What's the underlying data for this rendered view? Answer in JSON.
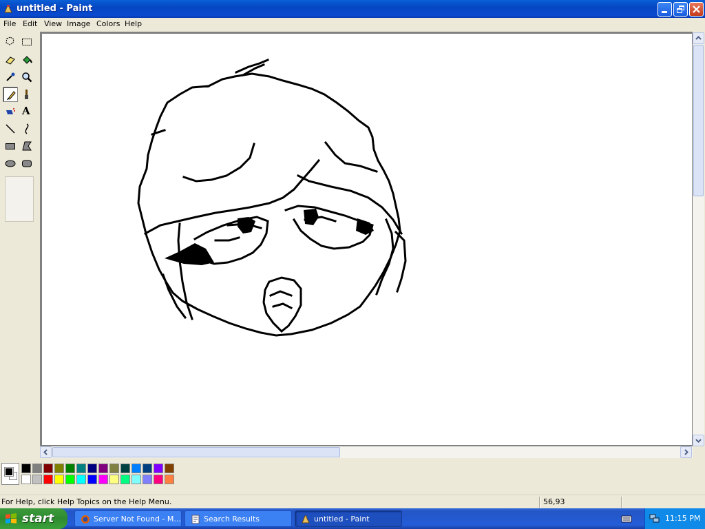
{
  "window": {
    "title": "untitled - Paint",
    "controls": [
      "minimize",
      "restore",
      "close"
    ]
  },
  "menu": [
    "File",
    "Edit",
    "View",
    "Image",
    "Colors",
    "Help"
  ],
  "tools": [
    {
      "name": "free-form-select",
      "icon": "free-select-icon"
    },
    {
      "name": "select",
      "icon": "rect-select-icon"
    },
    {
      "name": "eraser",
      "icon": "eraser-icon"
    },
    {
      "name": "fill-with-color",
      "icon": "fill-bucket-icon"
    },
    {
      "name": "pick-color",
      "icon": "eyedropper-icon"
    },
    {
      "name": "magnifier",
      "icon": "magnifier-icon"
    },
    {
      "name": "pencil",
      "icon": "pencil-icon",
      "selected": true
    },
    {
      "name": "brush",
      "icon": "brush-icon"
    },
    {
      "name": "airbrush",
      "icon": "airbrush-icon"
    },
    {
      "name": "text",
      "icon": "text-icon",
      "glyph": "A"
    },
    {
      "name": "line",
      "icon": "line-icon"
    },
    {
      "name": "curve",
      "icon": "curve-icon"
    },
    {
      "name": "rectangle",
      "icon": "rectangle-icon"
    },
    {
      "name": "polygon",
      "icon": "polygon-icon"
    },
    {
      "name": "ellipse",
      "icon": "ellipse-icon"
    },
    {
      "name": "rounded-rectangle",
      "icon": "rounded-rect-icon"
    }
  ],
  "palette": {
    "foreground": "#000000",
    "background": "#ffffff",
    "row1": [
      "#000000",
      "#808080",
      "#800000",
      "#808000",
      "#008000",
      "#008080",
      "#000080",
      "#800080",
      "#808040",
      "#004040",
      "#0080ff",
      "#004080",
      "#8000ff",
      "#804000"
    ],
    "row2": [
      "#ffffff",
      "#c0c0c0",
      "#ff0000",
      "#ffff00",
      "#00ff00",
      "#00ffff",
      "#0000ff",
      "#ff00ff",
      "#ffff80",
      "#00ff80",
      "#80ffff",
      "#8080ff",
      "#ff0080",
      "#ff8040"
    ]
  },
  "status": {
    "help": "For Help, click Help Topics on the Help Menu.",
    "coords": "56,93"
  },
  "taskbar": {
    "start": "start",
    "tasks": [
      {
        "label": "Server Not Found - M...",
        "icon": "firefox-icon",
        "active": false
      },
      {
        "label": "Search Results",
        "icon": "search-results-icon",
        "active": false
      },
      {
        "label": "untitled - Paint",
        "icon": "paint-icon",
        "active": true
      }
    ],
    "clock": "11:15 PM"
  }
}
